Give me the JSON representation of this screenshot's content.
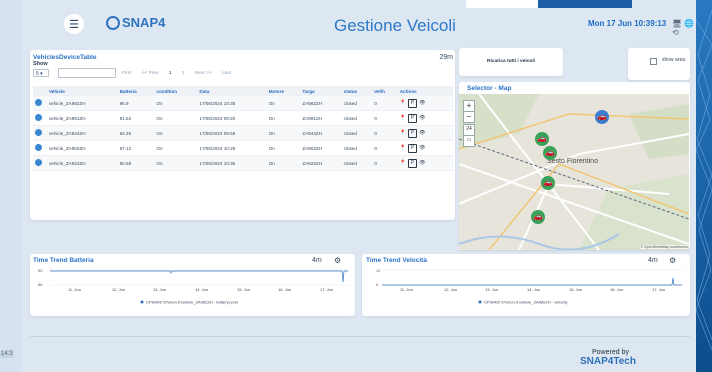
{
  "header": {
    "logo_text": "SNAP4",
    "title": "Gestione Veicoli",
    "datetime": "Mon 17 Jun 10:39:13",
    "icons_text": "🖥 🌐 ⟲"
  },
  "side_clock": "14:3",
  "vehicles_table": {
    "title": "VehiclesDeviceTable",
    "show_label": "Show",
    "show_value": "5",
    "age": "29m",
    "pagination": {
      "first": "First",
      "prev": "<< Prev",
      "page1": "1",
      "page2": "2",
      "next": "Next >>",
      "last": "Last"
    },
    "columns": [
      "Vehicle",
      "Batteria",
      "condition",
      "Data",
      "Motore",
      "Targa",
      "status",
      "Vel/h",
      "Actions"
    ],
    "rows": [
      {
        "vehicle": "vehicle_ZA982ZH",
        "battery": "95.9",
        "condition": "On",
        "date": "17/06/2024 10:35",
        "engine": "On",
        "plate": "ZA982ZH",
        "status": "closed",
        "speed": "0"
      },
      {
        "vehicle": "vehicle_ZA991ZH",
        "battery": "91.52",
        "condition": "On",
        "date": "17/06/2024 09:20",
        "engine": "On",
        "plate": "ZA991ZH",
        "status": "closed",
        "speed": "0"
      },
      {
        "vehicle": "vehicle_ZA944ZH",
        "battery": "94.26",
        "condition": "On",
        "date": "17/06/2024 09:58",
        "engine": "On",
        "plate": "ZA944ZH",
        "status": "closed",
        "speed": "0"
      },
      {
        "vehicle": "vehicle_ZA902ZH",
        "battery": "87.12",
        "condition": "On",
        "date": "17/06/2024 10:29",
        "engine": "On",
        "plate": "ZA902ZH",
        "status": "closed",
        "speed": "0"
      },
      {
        "vehicle": "vehicle_ZA922ZH",
        "battery": "90.59",
        "condition": "On",
        "date": "17/06/2024 10:36",
        "engine": "On",
        "plate": "ZA922ZH",
        "status": "closed",
        "speed": "0"
      }
    ]
  },
  "reset_card": {
    "button_label": "Ricarica tutti i veicoli"
  },
  "checkbox_card": {
    "label": "show area"
  },
  "map": {
    "title": "Selector - Map",
    "zoom_in": "+",
    "zoom_out": "−",
    "label_24": "24",
    "place_label": "Sesto Fiorentino",
    "attribution": "© OpenStreetMap contributors"
  },
  "trend_battery": {
    "title": "Time Trend Batteria",
    "age": "4m",
    "legend": "CPSM00 STorion.it:vehicle_ZA982ZH - batteryLevel",
    "y_ticks": [
      "90",
      "86"
    ],
    "x_ticks": [
      "11. Jun",
      "12. Jun",
      "13. Jun",
      "14. Jun",
      "15. Jun",
      "16. Jun",
      "17. Jun"
    ]
  },
  "trend_speed": {
    "title": "Time Trend Velocità",
    "age": "4m",
    "legend": "CPSM00 STorion.it:vehicle_ZA982ZH - velocity",
    "y_ticks": [
      "12",
      "0"
    ],
    "x_ticks": [
      "11. Jun",
      "12. Jun",
      "13. Jun",
      "14. Jun",
      "15. Jun",
      "16. Jun",
      "17. Jun"
    ]
  },
  "footer": {
    "powered_by": "Powered by",
    "brand": "SNAP4Tech"
  },
  "colors": {
    "accent": "#2d78c9",
    "background": "#cfdceb",
    "card": "#ffffff"
  }
}
